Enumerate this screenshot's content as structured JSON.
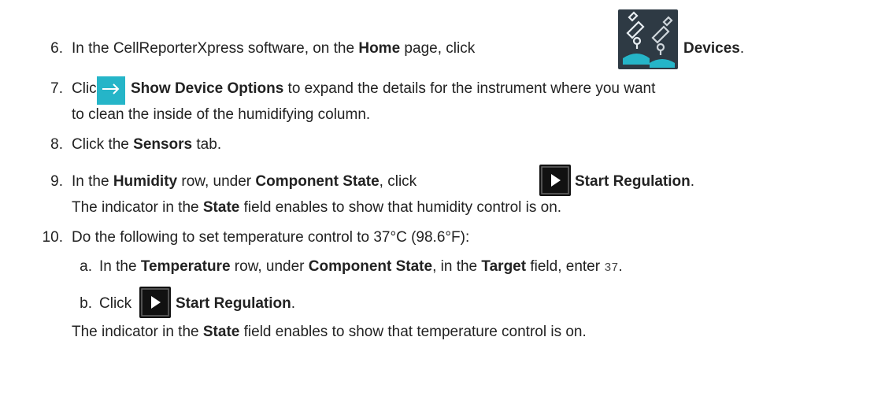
{
  "steps": [
    {
      "number": "6.",
      "pre": "In the CellReporterXpress software, on the ",
      "bold1": "Home",
      "mid": " page, click ",
      "icon": "devices-icon",
      "bold2": "Devices",
      "post": "."
    },
    {
      "number": "7.",
      "pre": "Click ",
      "icon": "arrow-right-icon",
      "bold1": "Show Device Options",
      "post": " to expand the details for the instrument where you want",
      "line2": "to clean the inside of the humidifying column."
    },
    {
      "number": "8.",
      "pre": "Click the ",
      "bold1": "Sensors",
      "post": " tab."
    },
    {
      "number": "9.",
      "pre": "In the ",
      "bold1": "Humidity",
      "mid1": " row, under ",
      "bold2": "Component State",
      "mid2": ", click ",
      "icon": "play-icon",
      "bold3": "Start Regulation",
      "post": ".",
      "result_pre": "The indicator in the ",
      "result_bold": "State",
      "result_post": " field enables to show that humidity control is on."
    },
    {
      "number": "10.",
      "text": "Do the following to set temperature control to 37°C (98.6°F):",
      "substeps": [
        {
          "letter": "a.",
          "pre": "In the ",
          "bold1": "Temperature",
          "mid1": " row, under ",
          "bold2": "Component State",
          "mid2": ", in the ",
          "bold3": "Target",
          "mid3": " field, enter ",
          "code": "37",
          "post": "."
        },
        {
          "letter": "b.",
          "pre": "Click ",
          "icon": "play-icon",
          "bold1": "Start Regulation",
          "post": "."
        }
      ],
      "result_pre": "The indicator in the ",
      "result_bold": "State",
      "result_post": " field enables to show that temperature control is on."
    }
  ],
  "colors": {
    "devices_icon_bg": "#2e3a44",
    "arrow_icon_bg": "#25b5c8",
    "play_icon_bg": "#111111",
    "text": "#222222"
  }
}
